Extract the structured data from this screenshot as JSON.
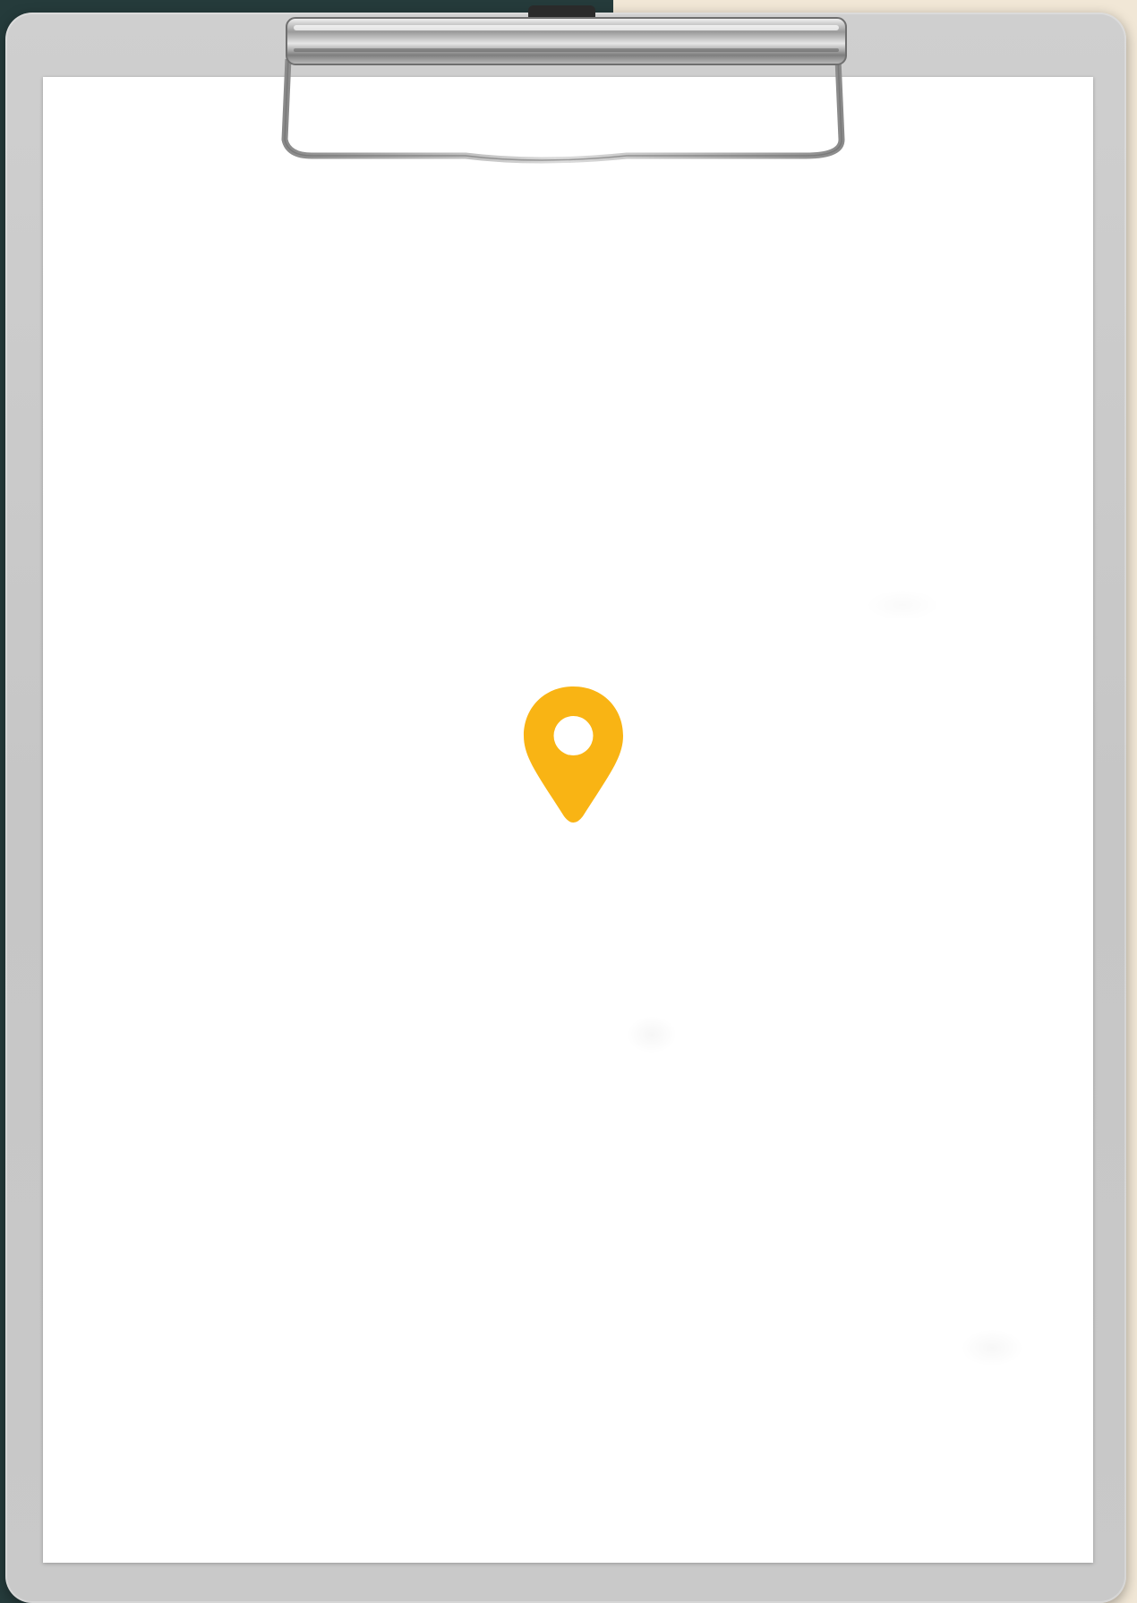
{
  "scene": {
    "description_icon": "map-pin-icon",
    "colors": {
      "background_left": "#253b3b",
      "background_right": "#f1e7d6",
      "clipboard_board": "#cbcbcb",
      "paper": "#ffffff",
      "pin": "#f9b414"
    }
  }
}
